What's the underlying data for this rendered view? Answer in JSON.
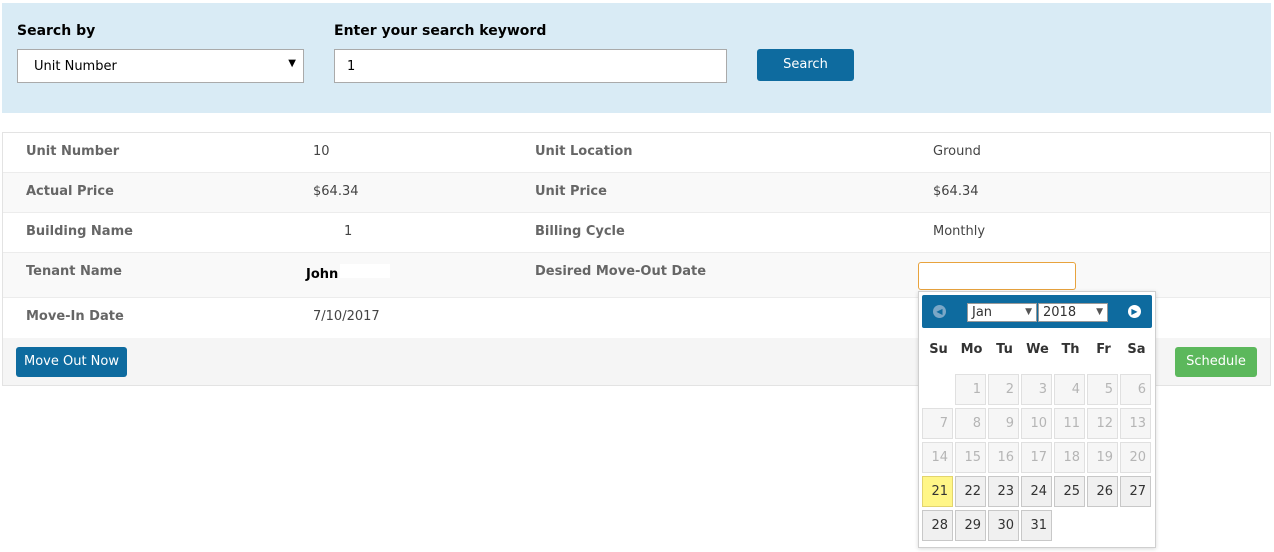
{
  "search": {
    "by_label": "Search by",
    "by_value": "Unit Number",
    "keyword_label": "Enter your search keyword",
    "keyword_value": "1",
    "button_label": "Search"
  },
  "details": {
    "unit_number_label": "Unit Number",
    "unit_number_value": "10",
    "unit_location_label": "Unit Location",
    "unit_location_value": "Ground",
    "actual_price_label": "Actual Price",
    "actual_price_value": "$64.34",
    "unit_price_label": "Unit Price",
    "unit_price_value": "$64.34",
    "building_name_label": "Building Name",
    "building_name_value": "1",
    "billing_cycle_label": "Billing Cycle",
    "billing_cycle_value": "Monthly",
    "tenant_name_label": "Tenant Name",
    "tenant_name_value": "John",
    "move_out_date_label": "Desired Move-Out Date",
    "move_in_date_label": "Move-In Date",
    "move_in_date_value": "7/10/2017"
  },
  "actions": {
    "move_out_now": "Move Out Now",
    "schedule": "Schedule"
  },
  "datepicker": {
    "month": "Jan",
    "year": "2018",
    "weekdays": [
      "Su",
      "Mo",
      "Tu",
      "We",
      "Th",
      "Fr",
      "Sa"
    ],
    "first_weekday_index": 1,
    "days_in_month": 31,
    "today": 21,
    "first_selectable_day": 21,
    "prev_icon": "prev-circle-icon",
    "next_icon": "next-circle-icon"
  },
  "colors": {
    "primary": "#0e6b9f",
    "success": "#5cb85c",
    "panel": "#d9ebf5",
    "today_highlight": "#fff687",
    "input_focus_border": "#e8a33d"
  }
}
